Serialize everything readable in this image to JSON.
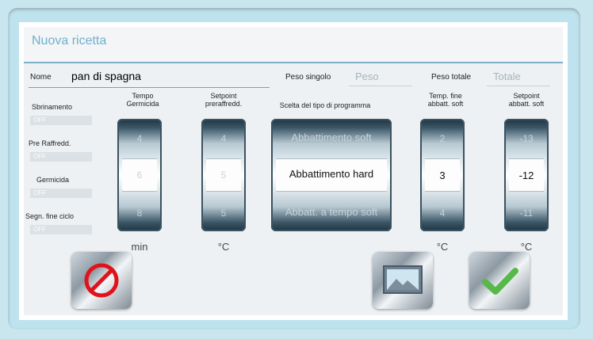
{
  "title": "Nuova ricetta",
  "name_label": "Nome",
  "name_value": "pan di spagna",
  "peso_singolo_label": "Peso singolo",
  "peso_placeholder": "Peso",
  "peso_totale_label": "Peso totale",
  "totale_placeholder": "Totale",
  "headers": {
    "tempo_germicida": "Tempo\nGermicida",
    "setpoint_preraff": "Setpoint\npreraffredd.",
    "scelta": "Scelta del tipo di programma",
    "temp_fine": "Temp. fine\nabbatt. soft",
    "setpoint_abbatt": "Setpoint\nabbatt. soft"
  },
  "side": {
    "sbrinamento": "Sbrinamento",
    "preraff": "Pre Raffredd.",
    "germicida": "Germicida",
    "segn": "Segn. fine ciclo",
    "off": "OFF"
  },
  "wheels": {
    "germicida": [
      "4",
      "6",
      "8"
    ],
    "preraff": [
      "4",
      "5",
      "5"
    ],
    "programma": [
      "Abbattimento soft",
      "Abbattimento hard",
      "Abbatt. a tempo soft"
    ],
    "temp_fine": [
      "2",
      "3",
      "4"
    ],
    "setpoint_abbatt": [
      "-13",
      "-12",
      "-11"
    ]
  },
  "units": {
    "min": "min",
    "c1": "°C",
    "c2": "°C",
    "c3": "°C"
  },
  "icons": [
    "cancel-icon",
    "image-icon",
    "confirm-check-icon"
  ],
  "colors": {
    "accent": "#6fb0d0",
    "cancel": "#e0121b",
    "confirm": "#58b84a"
  }
}
